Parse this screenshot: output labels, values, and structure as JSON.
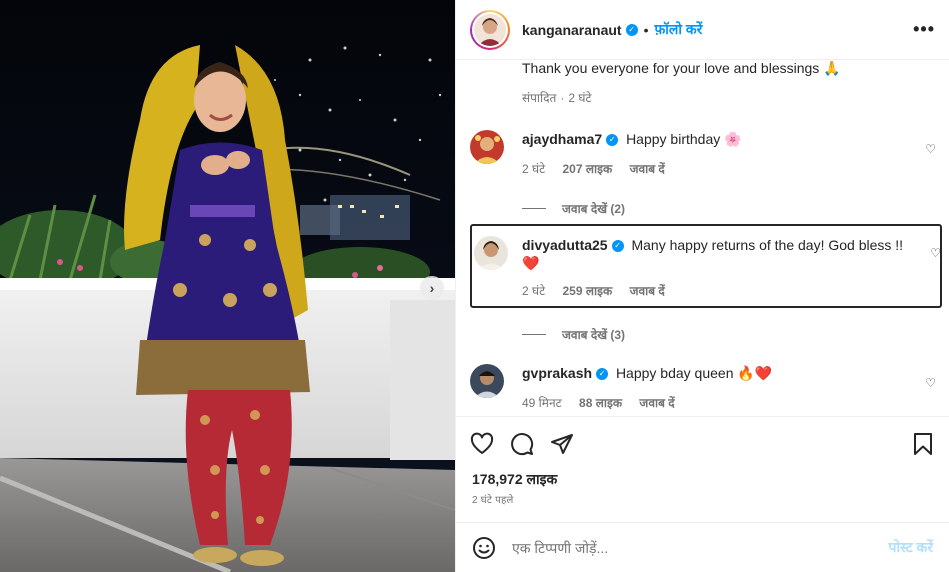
{
  "post_author": {
    "username": "kanganaranaut",
    "verified_icon": "verified-badge-icon",
    "follow_label": "फ़ॉलो करें",
    "separator": "•"
  },
  "caption": {
    "text": "Thank you everyone for your love and blessings 🙏",
    "edited_label": "संपादित",
    "time": "2 घंटे"
  },
  "comments": [
    {
      "username": "ajaydhama7",
      "text": "Happy birthday 🌸",
      "time": "2 घंटे",
      "likes": "207 लाइक",
      "reply_label": "जवाब दें",
      "view_replies": "जवाब देखें (2)"
    },
    {
      "username": "divyadutta25",
      "text": "Many happy returns of the day! God bless !!",
      "text2": "❤️",
      "time": "2 घंटे",
      "likes": "259 लाइक",
      "reply_label": "जवाब दें",
      "view_replies": "जवाब देखें (3)"
    },
    {
      "username": "gvprakash",
      "text": "Happy bday queen 🔥❤️",
      "time": "49 मिनट",
      "likes": "88 लाइक",
      "reply_label": "जवाब दें"
    }
  ],
  "stats": {
    "likes": "178,972 लाइक",
    "posted": "2 घंटे पहले"
  },
  "add_comment": {
    "placeholder": "एक टिप्पणी जोड़ें...",
    "post_label": "पोस्ट करें"
  },
  "colors": {
    "accent": "#0095f6",
    "post_disabled": "#b2dffc",
    "muted": "#737373"
  }
}
